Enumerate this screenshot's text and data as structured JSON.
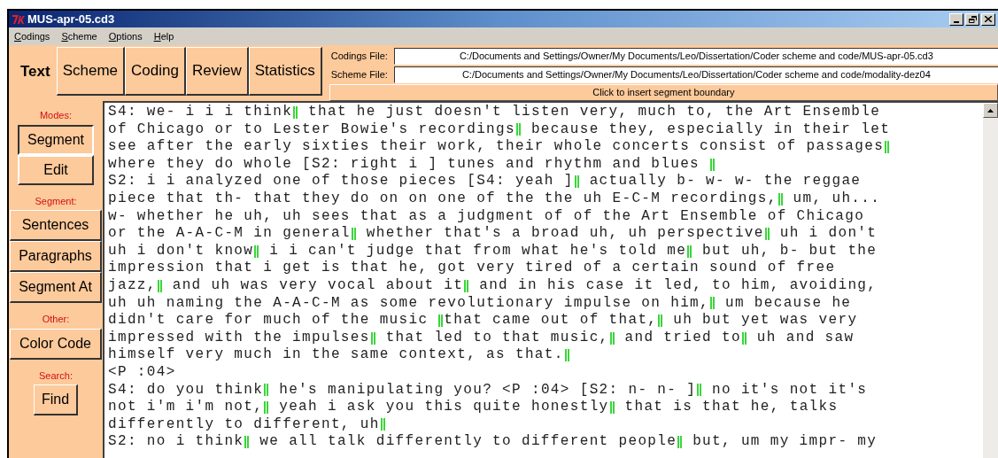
{
  "window": {
    "title": "MUS-apr-05.cd3"
  },
  "menu": [
    "Codings",
    "Scheme",
    "Options",
    "Help"
  ],
  "tabs": [
    {
      "label": "Text",
      "selected": true
    },
    {
      "label": "Scheme",
      "selected": false
    },
    {
      "label": "Coding",
      "selected": false
    },
    {
      "label": "Review",
      "selected": false
    },
    {
      "label": "Statistics",
      "selected": false
    }
  ],
  "files": [
    {
      "label": "Codings File:",
      "value": "C:/Documents and Settings/Owner/My Documents/Leo/Dissertation/Coder scheme and code/MUS-apr-05.cd3"
    },
    {
      "label": "Scheme File:",
      "value": "C:/Documents and Settings/Owner/My Documents/Leo/Dissertation/Coder scheme and code/modality-dez04"
    }
  ],
  "insert_button": "Click to insert segment boundary",
  "sidebar": [
    {
      "kind": "heading",
      "text": "Modes:"
    },
    {
      "kind": "mode",
      "label": "Segment",
      "selected": true
    },
    {
      "kind": "mode",
      "label": "Edit",
      "selected": false
    },
    {
      "kind": "heading",
      "text": "Segment:"
    },
    {
      "kind": "button",
      "label": "Sentences"
    },
    {
      "kind": "button",
      "label": "Paragraphs"
    },
    {
      "kind": "button",
      "label": "Segment At"
    },
    {
      "kind": "heading",
      "text": "Other:"
    },
    {
      "kind": "button",
      "label": "Color Code"
    },
    {
      "kind": "heading",
      "text": "Search:"
    },
    {
      "kind": "small_button",
      "label": "Find"
    }
  ],
  "lines": [
    {
      "tokens": [
        {
          "kind": "text",
          "text": "S4: we- i i i think"
        },
        {
          "kind": "boundary"
        },
        {
          "kind": "text",
          "text": " that he just doesn't listen very, much to, the Art Ensemble"
        }
      ]
    },
    {
      "tokens": [
        {
          "kind": "text",
          "text": "of Chicago or to Lester Bowie's recordings"
        },
        {
          "kind": "boundary"
        },
        {
          "kind": "text",
          "text": " because they, especially in their let"
        }
      ]
    },
    {
      "tokens": [
        {
          "kind": "text",
          "text": "see after the early sixties their work, their whole concerts consist of passages"
        },
        {
          "kind": "boundary"
        }
      ]
    },
    {
      "tokens": [
        {
          "kind": "text",
          "text": "where they do whole [S2: right i ] tunes and rhythm and blues "
        },
        {
          "kind": "boundary"
        }
      ]
    },
    {
      "tokens": [
        {
          "kind": "text",
          "text": "S2: i i analyzed one of those pieces [S4: yeah ]"
        },
        {
          "kind": "boundary"
        },
        {
          "kind": "text",
          "text": " actually b- w- w- the reggae"
        }
      ]
    },
    {
      "tokens": [
        {
          "kind": "text",
          "text": "piece that th- that they do on on one of the the uh E-C-M recordings,"
        },
        {
          "kind": "boundary"
        },
        {
          "kind": "text",
          "text": " um, uh..."
        }
      ]
    },
    {
      "tokens": [
        {
          "kind": "text",
          "text": "w- whether he uh, uh sees that as a judgment of of the Art Ensemble of Chicago"
        }
      ]
    },
    {
      "tokens": [
        {
          "kind": "text",
          "text": "or the A-A-C-M in general"
        },
        {
          "kind": "boundary"
        },
        {
          "kind": "text",
          "text": " whether that's a broad uh, uh perspective"
        },
        {
          "kind": "boundary"
        },
        {
          "kind": "text",
          "text": " uh i don't"
        }
      ]
    },
    {
      "tokens": [
        {
          "kind": "text",
          "text": "uh i don't know"
        },
        {
          "kind": "boundary"
        },
        {
          "kind": "text",
          "text": " i i can't judge that from what he's told me"
        },
        {
          "kind": "boundary"
        },
        {
          "kind": "text",
          "text": " but uh, b- but the"
        }
      ]
    },
    {
      "tokens": [
        {
          "kind": "text",
          "text": "impression that i get is that he, got very tired of a certain sound of free"
        }
      ]
    },
    {
      "tokens": [
        {
          "kind": "text",
          "text": "jazz,"
        },
        {
          "kind": "boundary"
        },
        {
          "kind": "text",
          "text": " and uh was very vocal about it"
        },
        {
          "kind": "boundary"
        },
        {
          "kind": "text",
          "text": " and in his case it led, to him, avoiding,"
        }
      ]
    },
    {
      "tokens": [
        {
          "kind": "text",
          "text": "uh uh naming the A-A-C-M as some revolutionary impulse on him,"
        },
        {
          "kind": "boundary"
        },
        {
          "kind": "text",
          "text": " um because he"
        }
      ]
    },
    {
      "tokens": [
        {
          "kind": "text",
          "text": "didn't care for much of the music "
        },
        {
          "kind": "boundary"
        },
        {
          "kind": "text",
          "text": "that came out of that,"
        },
        {
          "kind": "boundary"
        },
        {
          "kind": "text",
          "text": " uh but yet was very"
        }
      ]
    },
    {
      "tokens": [
        {
          "kind": "text",
          "text": "impressed with the impulses"
        },
        {
          "kind": "boundary"
        },
        {
          "kind": "text",
          "text": " that led to that music,"
        },
        {
          "kind": "boundary"
        },
        {
          "kind": "text",
          "text": " and tried to"
        },
        {
          "kind": "boundary"
        },
        {
          "kind": "text",
          "text": " uh and saw"
        }
      ]
    },
    {
      "tokens": [
        {
          "kind": "text",
          "text": "himself very much in the same context, as that."
        },
        {
          "kind": "boundary"
        }
      ]
    },
    {
      "tokens": [
        {
          "kind": "text",
          "text": "<P :04>"
        }
      ]
    },
    {
      "tokens": [
        {
          "kind": "text",
          "text": "S4: do you think"
        },
        {
          "kind": "boundary"
        },
        {
          "kind": "text",
          "text": " he's manipulating you? <P :04> [S2: n- n- ]"
        },
        {
          "kind": "boundary"
        },
        {
          "kind": "text",
          "text": " no it's not it's"
        }
      ]
    },
    {
      "tokens": [
        {
          "kind": "text",
          "text": "not i'm i'm not,"
        },
        {
          "kind": "boundary"
        },
        {
          "kind": "text",
          "text": " yeah i ask you this quite honestly"
        },
        {
          "kind": "boundary"
        },
        {
          "kind": "text",
          "text": " that is that he, talks"
        }
      ]
    },
    {
      "tokens": [
        {
          "kind": "text",
          "text": "differently to different, uh"
        },
        {
          "kind": "boundary"
        }
      ]
    },
    {
      "tokens": [
        {
          "kind": "text",
          "text": "S2: no i think"
        },
        {
          "kind": "boundary"
        },
        {
          "kind": "text",
          "text": " we all talk differently to different people"
        },
        {
          "kind": "boundary"
        },
        {
          "kind": "text",
          "text": " but, um my impr- my"
        }
      ]
    }
  ]
}
